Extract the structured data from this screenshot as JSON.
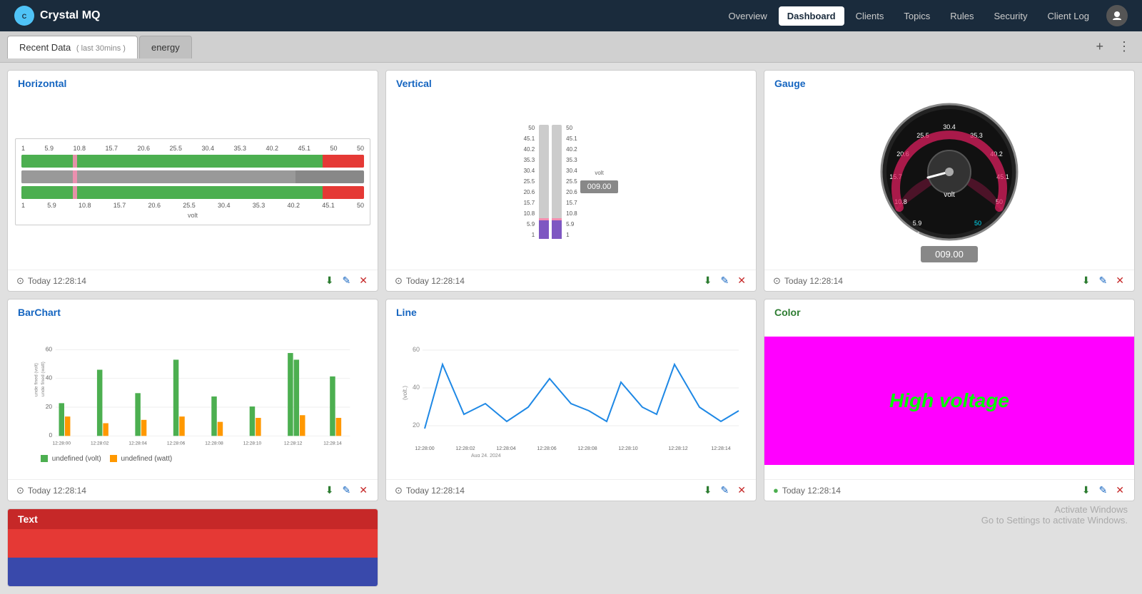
{
  "brand": {
    "name": "Crystal MQ",
    "logo_text": "C"
  },
  "nav": {
    "links": [
      {
        "label": "Overview",
        "active": false
      },
      {
        "label": "Dashboard",
        "active": true
      },
      {
        "label": "Clients",
        "active": false
      },
      {
        "label": "Topics",
        "active": false
      },
      {
        "label": "Rules",
        "active": false
      },
      {
        "label": "Security",
        "active": false
      },
      {
        "label": "Client Log",
        "active": false
      }
    ]
  },
  "tabs": {
    "recent_data_label": "Recent Data",
    "recent_data_sub": "( last 30mins )",
    "energy_label": "energy",
    "add_label": "+",
    "menu_label": "⋮"
  },
  "widgets": {
    "horizontal": {
      "title": "Horizontal",
      "scale_top": [
        "1",
        "5.9",
        "10.8",
        "15.7",
        "20.6",
        "25.5",
        "30.4",
        "35.3",
        "40.2",
        "45.1",
        "50",
        "50"
      ],
      "scale_bottom": [
        "1",
        "5.9",
        "10.8",
        "15.7",
        "20.6",
        "25.5",
        "30.4",
        "35.3",
        "40.2",
        "45.1",
        "50"
      ],
      "unit": "volt",
      "timestamp": "Today 12:28:14"
    },
    "vertical": {
      "title": "Vertical",
      "scale_left": [
        "50",
        "45.1",
        "40.2",
        "35.3",
        "30.4",
        "25.5",
        "20.6",
        "15.7",
        "10.8",
        "5.9",
        "1"
      ],
      "scale_right": [
        "50",
        "45.1",
        "40.2",
        "35.3",
        "30.4",
        "25.5",
        "20.6",
        "15.7",
        "10.8",
        "5.9",
        "1"
      ],
      "unit": "volt",
      "display": "009.00",
      "timestamp": "Today 12:28:14"
    },
    "gauge": {
      "title": "Gauge",
      "labels": [
        "5.9",
        "10.8",
        "15.7",
        "20.6",
        "25.5",
        "30.4",
        "35.3",
        "40.2",
        "45.1",
        "50"
      ],
      "unit": "volt",
      "display": "009.00",
      "timestamp": "Today 12:28:14",
      "min": 1,
      "max": 50,
      "value": 9
    },
    "barchart": {
      "title": "BarChart",
      "y_max": 60,
      "y_labels": [
        "60",
        "40",
        "20",
        "0"
      ],
      "x_labels": [
        "12:28:00",
        "12:28:02",
        "12:28:04",
        "12:28:06",
        "12:28:08",
        "12:28:10",
        "12:28:12",
        "12:28:14"
      ],
      "legend": [
        "undefined (volt)",
        "undefined (watt)"
      ],
      "timestamp": "Today 12:28:14"
    },
    "line": {
      "title": "Line",
      "y_max": 60,
      "y_min": 20,
      "y_labels": [
        "60",
        "40",
        "20"
      ],
      "x_labels": [
        "12:28:00",
        "12:28:02",
        "12:28:04",
        "12:28:06",
        "12:28:08",
        "12:28:10",
        "12:28:12",
        "12:28:14"
      ],
      "x_sub": "Aug 24, 2024",
      "unit": "(volt.)",
      "timestamp": "Today 12:28:14"
    },
    "color": {
      "title": "Color",
      "bg_color": "#ff00ff",
      "text": "High voltage",
      "text_color": "#00ff00",
      "timestamp": "Today 12:28:14",
      "status_color": "#4caf50"
    },
    "text": {
      "title": "Text",
      "top_color": "#e53935",
      "bottom_color": "#3949ab"
    }
  },
  "watermark": {
    "line1": "Activate Windows",
    "line2": "Go to Settings to activate Windows."
  }
}
